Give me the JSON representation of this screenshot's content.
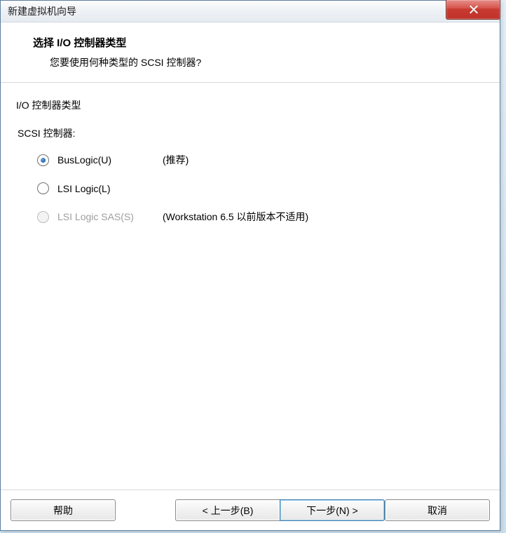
{
  "window": {
    "title": "新建虚拟机向导"
  },
  "header": {
    "title": "选择 I/O 控制器类型",
    "subtitle": "您要使用何种类型的 SCSI 控制器?"
  },
  "content": {
    "group_title": "I/O 控制器类型",
    "label": "SCSI 控制器:",
    "options": [
      {
        "label": "BusLogic(U)",
        "note": "(推荐)",
        "checked": true,
        "disabled": false
      },
      {
        "label": "LSI Logic(L)",
        "note": "",
        "checked": false,
        "disabled": false
      },
      {
        "label": "LSI Logic SAS(S)",
        "note": "(Workstation 6.5 以前版本不适用)",
        "checked": false,
        "disabled": true
      }
    ]
  },
  "footer": {
    "help": "帮助",
    "prev": "< 上一步(B)",
    "next": "下一步(N) >",
    "cancel": "取消"
  }
}
